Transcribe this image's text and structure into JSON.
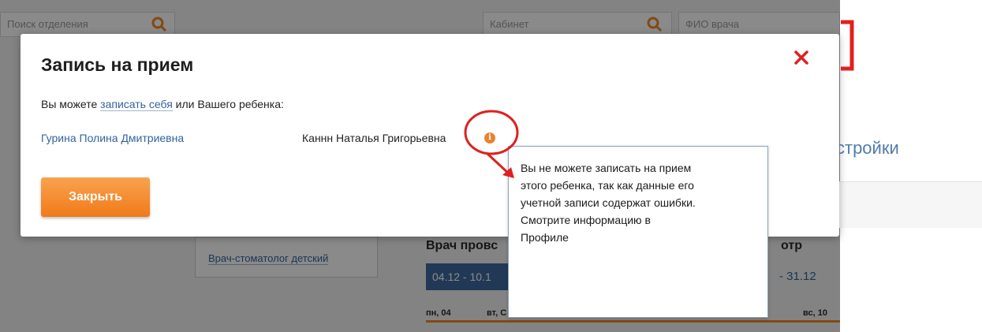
{
  "background": {
    "search_department_placeholder": "Поиск отделения",
    "cabinet_placeholder": "Кабинет",
    "doctor_placeholder": "ФИО врача",
    "specialty_link": "Врач-стоматолог детский",
    "doctor_heading": "Врач провс",
    "doctor_heading_right": "отр",
    "date_range": "04.12 - 10.1",
    "date_range_right": "- 31.12",
    "day_mon": "пн, 04",
    "day_tue": "вт, С",
    "day_sun": "вс, 10",
    "settings_link": "стройки"
  },
  "modal": {
    "title": "Запись на прием",
    "intro_prefix": "Вы можете",
    "self_link": "записать себя",
    "intro_suffix": "или Вашего ребенка:",
    "child_link": "Гурина Полина Дмитриевна",
    "child_name": "Каннн Наталья Григорьевна",
    "close_button": "Закрыть"
  },
  "tooltip": {
    "line1": "Вы не можете записать на прием",
    "line2": "этого ребенка, так как данные его",
    "line3": "учетной записи содержат ошибки.",
    "line4": "Смотрите информацию в",
    "line5": "Профиле"
  },
  "colors": {
    "annotation_red": "#e02020",
    "accent_orange": "#f07a19",
    "link_blue": "#34649c"
  },
  "icons": {
    "search": "search-icon",
    "close": "close-icon",
    "info": "info-icon"
  }
}
